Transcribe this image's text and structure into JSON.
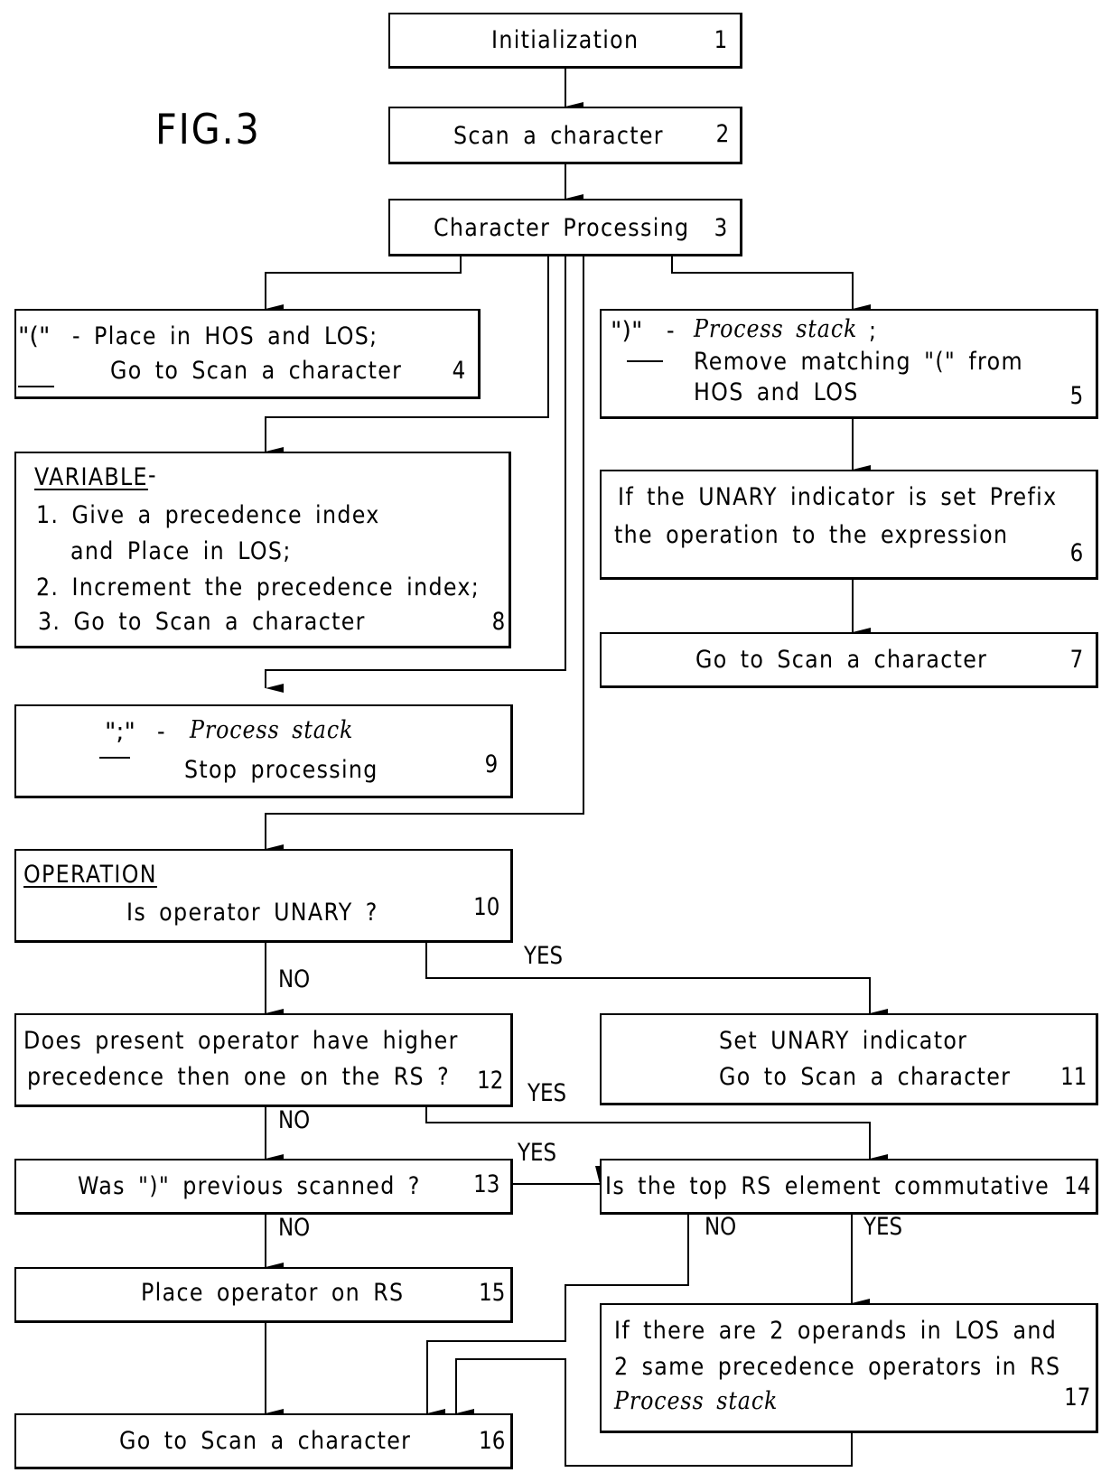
{
  "figure_label": "FIG.3",
  "boxes": {
    "b1": {
      "lines": [
        "Initialization"
      ],
      "num": "1"
    },
    "b2": {
      "lines": [
        "Scan a character"
      ],
      "num": "2"
    },
    "b3": {
      "lines": [
        "Character Processing"
      ],
      "num": "3"
    },
    "b4": {
      "key": "\"(\"",
      "lines": [
        "- Place in HOS and LOS;",
        "Go to Scan a character"
      ],
      "num": "4"
    },
    "b5": {
      "key": "\")\"",
      "italic": "Process stack",
      "lines": [
        "- ",
        ";",
        "Remove matching \"(\" from",
        "HOS and LOS"
      ],
      "num": "5"
    },
    "b6": {
      "lines": [
        "If the UNARY indicator is set Prefix",
        "the operation to the expression"
      ],
      "num": "6"
    },
    "b7": {
      "lines": [
        "Go to Scan a character"
      ],
      "num": "7"
    },
    "b8": {
      "heading": "VARIABLE",
      "heading_suffix": "-",
      "lines": [
        "1. Give a precedence index",
        "and Place in LOS;",
        "2. Increment the precedence index;",
        "3. Go to Scan a character"
      ],
      "num": "8"
    },
    "b9": {
      "key": "\";\"",
      "dash": "-",
      "italic": "Process stack",
      "lines": [
        "Stop processing"
      ],
      "num": "9"
    },
    "b10": {
      "heading": "OPERATION",
      "lines": [
        "Is operator UNARY ?"
      ],
      "num": "10"
    },
    "b11": {
      "lines": [
        "Set UNARY indicator",
        "Go to Scan a character"
      ],
      "num": "11"
    },
    "b12": {
      "lines": [
        "Does present operator have higher",
        "precedence then one on the RS ?"
      ],
      "num": "12"
    },
    "b13": {
      "lines": [
        "Was \")\" previous scanned ?"
      ],
      "num": "13"
    },
    "b14": {
      "lines": [
        "Is the top RS element commutative"
      ],
      "num": "14"
    },
    "b15": {
      "lines": [
        "Place operator on RS"
      ],
      "num": "15"
    },
    "b16": {
      "lines": [
        "Go to Scan a character"
      ],
      "num": "16"
    },
    "b17": {
      "lines": [
        "If there are 2 operands in LOS and",
        "2 same precedence operators in RS"
      ],
      "italic": "Process stack",
      "num": "17"
    }
  },
  "branch_labels": {
    "b10_yes": "YES",
    "b10_no": "NO",
    "b12_yes": "YES",
    "b12_no": "NO",
    "b13_yes": "YES",
    "b13_no": "NO",
    "b14_no": "NO",
    "b14_yes": "YES"
  }
}
